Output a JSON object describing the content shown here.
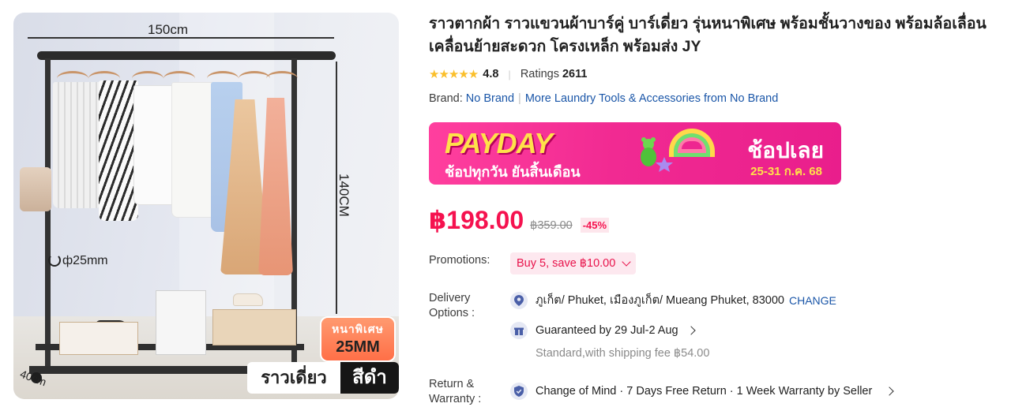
{
  "product_image": {
    "dim_width": "150cm",
    "dim_height": "140CM",
    "dim_depth": "40cm",
    "dim_pole": "ф25mm",
    "badge_line1": "หนาพิเศษ",
    "badge_line2": "25MM",
    "variant_label": "ราวเดี่ยว",
    "color_label": "สีดำ"
  },
  "product": {
    "title": "ราวตากผ้า ราวแขวนผ้าบาร์คู่ บาร์เดี่ยว รุ่นหนาพิเศษ พร้อมชั้นวางของ พร้อมล้อเลื่อน เคลื่อนย้ายสะดวก โครงเหล็ก พร้อมส่ง JY",
    "rating": "4.8",
    "ratings_label": "Ratings",
    "ratings_count": "2611",
    "brand_label": "Brand:",
    "brand_name": "No Brand",
    "more_from_brand": "More Laundry Tools & Accessories from No Brand"
  },
  "banner": {
    "title": "PAYDAY",
    "subtitle": "ช้อปทุกวัน ยันสิ้นเดือน",
    "cta": "ช้อปเลย",
    "date": "25-31 ก.ค. 68"
  },
  "pricing": {
    "price": "฿198.00",
    "original_price": "฿359.00",
    "discount": "-45%"
  },
  "promotions": {
    "label": "Promotions:",
    "chip": "Buy 5, save ฿10.00"
  },
  "delivery": {
    "label": "Delivery Options :",
    "location": "ภูเก็ต/ Phuket, เมืองภูเก็ต/ Mueang Phuket, 83000",
    "change": "CHANGE",
    "guarantee": "Guaranteed by 29 Jul-2 Aug",
    "shipping": "Standard,with shipping fee ฿54.00"
  },
  "return_warranty": {
    "label": "Return & Warranty :",
    "text": "Change of Mind · 7 Days Free Return · 1 Week Warranty by Seller"
  },
  "colors": {
    "price": "#f5124f",
    "link": "#1a56a8",
    "star": "#fabf2b",
    "banner": "#f12a92"
  }
}
